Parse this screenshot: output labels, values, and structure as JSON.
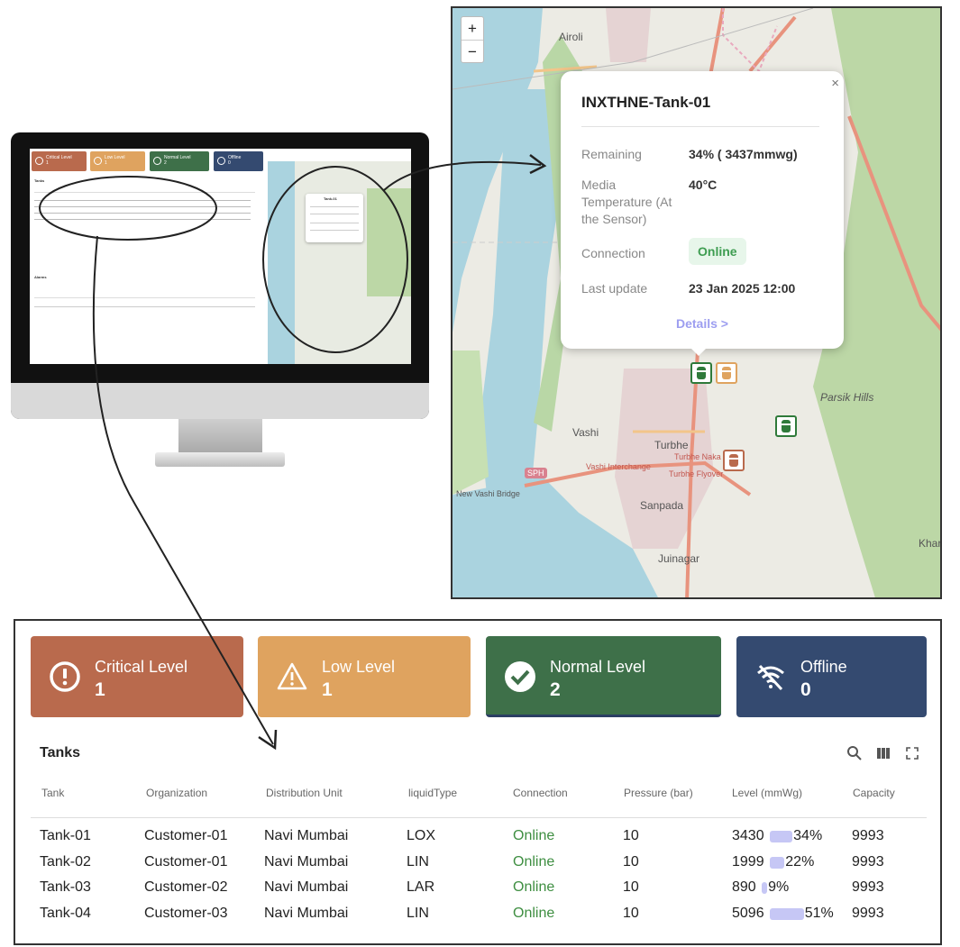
{
  "map": {
    "zoom_in": "+",
    "zoom_out": "−",
    "labels": {
      "airoli": "Airoli",
      "vashi": "Vashi",
      "turbhe": "Turbhe",
      "sanpada": "Sanpada",
      "juinagar": "Juinagar",
      "parsik_hills": "Parsik Hills",
      "new_vashi_bridge": "New Vashi Bridge",
      "sph": "SPH",
      "turbhe_naka": "Turbhe Naka",
      "turbhe_flyover": "Turbhe Flyover",
      "vashi_interchange": "Vashi Interchange",
      "kharghar": "Khar"
    },
    "popup": {
      "title": "INXTHNE-Tank-01",
      "close": "×",
      "remaining_label": "Remaining",
      "remaining_value": "34% ( 3437mmwg)",
      "temp_label": "Media Temperature (At the Sensor)",
      "temp_value": "40°C",
      "connection_label": "Connection",
      "connection_value": "Online",
      "last_update_label": "Last update",
      "last_update_value": "23 Jan 2025 12:00",
      "details_link": "Details >"
    }
  },
  "status_cards": [
    {
      "title": "Critical Level",
      "count": "1",
      "color": "#b96a4d",
      "icon": "alert-circle-icon"
    },
    {
      "title": "Low Level",
      "count": "1",
      "color": "#dfa35f",
      "icon": "warning-triangle-icon"
    },
    {
      "title": "Normal Level",
      "count": "2",
      "color": "#3e7049",
      "icon": "check-circle-icon"
    },
    {
      "title": "Offline",
      "count": "0",
      "color": "#344a70",
      "icon": "wifi-off-icon"
    }
  ],
  "tanks": {
    "title": "Tanks",
    "columns": [
      "Tank",
      "Organization",
      "Distribution Unit",
      "liquidType",
      "Connection",
      "Pressure (bar)",
      "Level (mmWg)",
      "Capacity"
    ],
    "rows": [
      {
        "tank": "Tank-01",
        "org": "Customer-01",
        "unit": "Navi Mumbai",
        "liquid": "LOX",
        "connection": "Online",
        "pressure": "10",
        "level": "3430",
        "level_pct": "34%",
        "level_frac": 0.34,
        "capacity": "9993"
      },
      {
        "tank": "Tank-02",
        "org": "Customer-01",
        "unit": "Navi Mumbai",
        "liquid": "LIN",
        "connection": "Online",
        "pressure": "10",
        "level": "1999",
        "level_pct": "22%",
        "level_frac": 0.22,
        "capacity": "9993"
      },
      {
        "tank": "Tank-03",
        "org": "Customer-02",
        "unit": "Navi Mumbai",
        "liquid": "LAR",
        "connection": "Online",
        "pressure": "10",
        "level": "890",
        "level_pct": "9%",
        "level_frac": 0.09,
        "capacity": "9993"
      },
      {
        "tank": "Tank-04",
        "org": "Customer-03",
        "unit": "Navi Mumbai",
        "liquid": "LIN",
        "connection": "Online",
        "pressure": "10",
        "level": "5096",
        "level_pct": "51%",
        "level_frac": 0.51,
        "capacity": "9993"
      }
    ]
  },
  "monitor": {
    "cards": [
      "Critical Level",
      "Low Level",
      "Normal Level",
      "Offline"
    ],
    "counts": [
      "1",
      "1",
      "2",
      "0"
    ],
    "tanks_title": "Tanks",
    "alarms_title": "Alarms",
    "popup_title": "Tank-01"
  }
}
